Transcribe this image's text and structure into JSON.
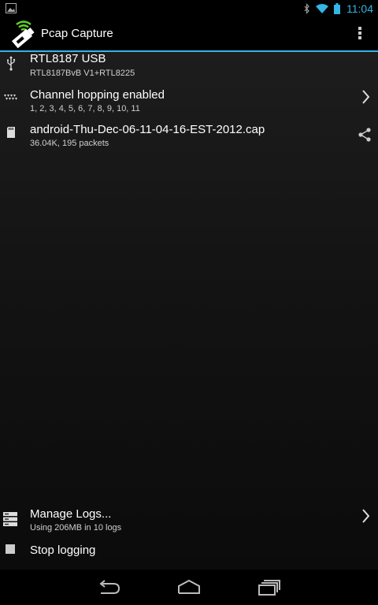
{
  "status_bar": {
    "time": "11:04",
    "icons": [
      "image-notification-icon",
      "bluetooth-icon",
      "wifi-icon",
      "battery-icon"
    ]
  },
  "action_bar": {
    "title": "Pcap Capture",
    "icons": [
      "app-icon",
      "overflow-menu-icon"
    ]
  },
  "list": {
    "items": [
      {
        "title": "RTL8187 USB",
        "summary": "RTL8187BvB V1+RTL8225",
        "icon": "usb-icon"
      },
      {
        "title": "Channel hopping enabled",
        "summary": "1, 2, 3, 4, 5, 6, 7, 8, 9, 10, 11",
        "icon": "channel-icon",
        "action_icon": "chevron-right-icon"
      },
      {
        "title": "android-Thu-Dec-06-11-04-16-EST-2012.cap",
        "summary": "36.04K, 195 packets",
        "icon": "sd-card-icon",
        "action_icon": "share-icon"
      }
    ]
  },
  "bottom": {
    "manage": {
      "title": "Manage Logs...",
      "summary": "Using 206MB in 10 logs",
      "icon": "storage-icon",
      "action_icon": "chevron-right-icon"
    },
    "stop": {
      "title": "Stop logging",
      "icon": "stop-icon"
    }
  },
  "nav": [
    "back-icon",
    "home-icon",
    "recent-apps-icon"
  ],
  "colors": {
    "accent": "#33b5e5",
    "background": "#000000"
  }
}
